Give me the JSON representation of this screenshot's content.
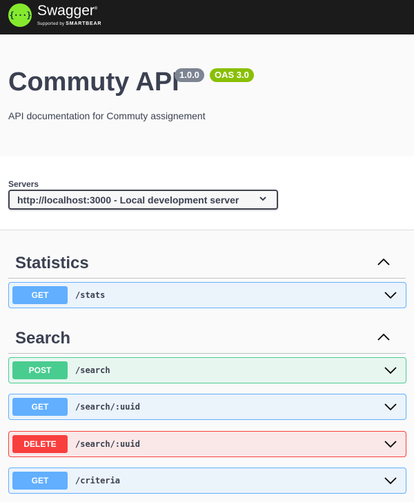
{
  "topbar": {
    "logo_glyph": "{···}",
    "brand": "Swagger",
    "brand_tm": "®",
    "supported_by": "Supported by",
    "smartbear": "SMARTBEAR"
  },
  "info": {
    "title": "Commuty API",
    "version": "1.0.0",
    "oas": "OAS 3.0",
    "description": "API documentation for Commuty assignement"
  },
  "servers": {
    "label": "Servers",
    "selected": "http://localhost:3000 - Local development server"
  },
  "tags": [
    {
      "name": "Statistics",
      "operations": [
        {
          "method": "GET",
          "path": "/stats"
        }
      ]
    },
    {
      "name": "Search",
      "operations": [
        {
          "method": "POST",
          "path": "/search"
        },
        {
          "method": "GET",
          "path": "/search/:uuid"
        },
        {
          "method": "DELETE",
          "path": "/search/:uuid"
        },
        {
          "method": "GET",
          "path": "/criteria"
        }
      ]
    }
  ],
  "colors": {
    "get": "#61affe",
    "post": "#49cc90",
    "delete": "#f93e3e",
    "brand_green": "#85ea2d",
    "topbar_bg": "#1b1b1b"
  }
}
